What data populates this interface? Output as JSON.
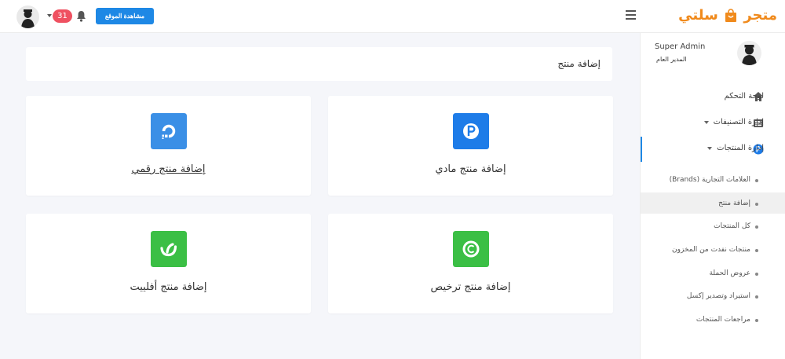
{
  "header": {
    "notifications_count": "31",
    "visit_site_label": "مشاهدة الموقع",
    "logo_word_1": "متجر",
    "logo_word_2": "سلتي",
    "icons": [
      "avatar",
      "chevron-down-icon",
      "bell-icon",
      "hamburger-icon",
      "shopping-bag-icon"
    ]
  },
  "sidebar": {
    "user_name": "Super Admin",
    "user_role": "المدير العام",
    "items": [
      {
        "label": "لوحة التحكم",
        "icon": "home-icon"
      },
      {
        "label": "إدارة التصنيفات",
        "icon": "list-icon"
      },
      {
        "label": "إدارة المنتجات",
        "icon": "product-p-icon"
      }
    ],
    "sub_items": [
      {
        "label": "العلامات التجارية (Brands)"
      },
      {
        "label": "إضافة منتج"
      },
      {
        "label": "كل المنتجات"
      },
      {
        "label": "منتجات نفدت من المخزون"
      },
      {
        "label": "عروض الحملة"
      },
      {
        "label": "استيراد وتصدير إكسل"
      },
      {
        "label": "مراجعات المنتجات"
      }
    ]
  },
  "main": {
    "page_title": "إضافة منتج",
    "cards": [
      {
        "label": "إضافة منتج مادي",
        "icon": "physical-product-icon",
        "color": "#1e7ce8"
      },
      {
        "label": "إضافة منتج رقمي",
        "icon": "digital-product-icon",
        "color": "#3a8fe6"
      },
      {
        "label": "إضافة منتج ترخيص",
        "icon": "license-icon",
        "color": "#3bbf45"
      },
      {
        "label": "إضافة منتج أفلييت",
        "icon": "affiliate-icon",
        "color": "#3bbf45"
      }
    ]
  },
  "colors": {
    "accent": "#1e88e5",
    "badge": "#ef5161",
    "logo": "#f08a1c",
    "background": "#f5f6fa"
  }
}
